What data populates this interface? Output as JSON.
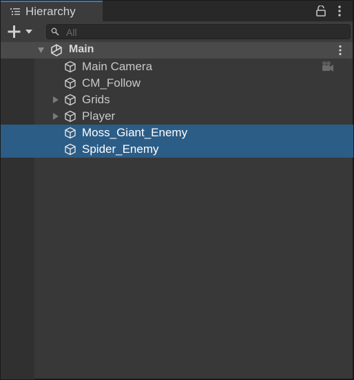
{
  "tab": {
    "title": "Hierarchy",
    "icon": "hierarchy-list-icon"
  },
  "toolbar": {
    "add_icon": "plus-dropdown-icon",
    "search_placeholder": "All",
    "search_icon": "search-icon"
  },
  "scene": {
    "name": "Main",
    "icon": "unity-logo-icon",
    "expanded": true
  },
  "items": [
    {
      "label": "Main Camera",
      "has_children": false,
      "selected": false,
      "extra_icon": "camera-gizmo-icon"
    },
    {
      "label": "CM_Follow",
      "has_children": false,
      "selected": false
    },
    {
      "label": "Grids",
      "has_children": true,
      "selected": false
    },
    {
      "label": "Player",
      "has_children": true,
      "selected": false
    },
    {
      "label": "Moss_Giant_Enemy",
      "has_children": false,
      "selected": true
    },
    {
      "label": "Spider_Enemy",
      "has_children": false,
      "selected": true
    }
  ],
  "colors": {
    "selection": "#2c5d87",
    "tab_accent": "#3a79bb",
    "background": "#383838"
  }
}
